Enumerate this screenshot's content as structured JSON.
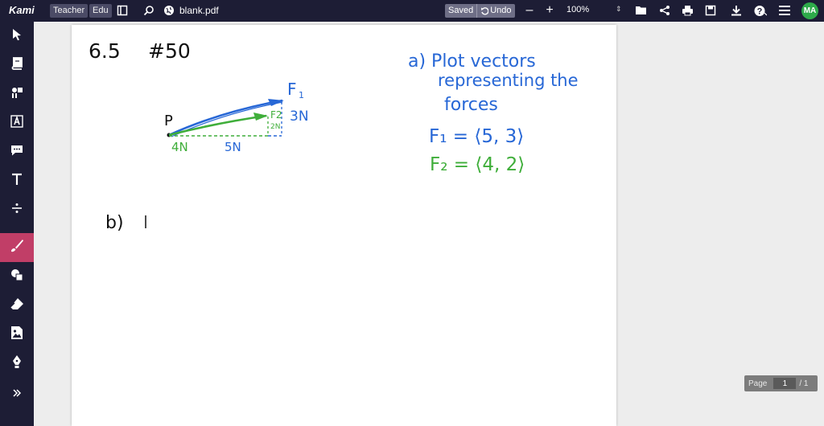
{
  "app": {
    "brand": "Kami"
  },
  "topbar": {
    "teacher_chip": "Teacher",
    "edu_chip": "Edu",
    "filename": "blank.pdf",
    "saved_label": "Saved",
    "undo_label": "Undo",
    "zoom_minus": "–",
    "zoom_plus": "+",
    "zoom_level": "100%",
    "avatar_initials": "MA",
    "accent_color": "#1d1d35"
  },
  "left_tools": [
    {
      "name": "select-tool",
      "icon": "cursor-icon"
    },
    {
      "name": "dictionary-tool",
      "icon": "book-icon"
    },
    {
      "name": "text-to-speech-tool",
      "icon": "speaker-icon"
    },
    {
      "name": "markup-tool",
      "icon": "highlight-icon"
    },
    {
      "name": "comment-tool",
      "icon": "comment-icon"
    },
    {
      "name": "text-tool",
      "icon": "text-icon"
    },
    {
      "name": "equation-tool",
      "icon": "divide-icon"
    },
    {
      "name": "drawing-tool",
      "icon": "brush-icon",
      "active": true
    },
    {
      "name": "shapes-tool",
      "icon": "shapes-icon"
    },
    {
      "name": "eraser-tool",
      "icon": "eraser-icon"
    },
    {
      "name": "image-tool",
      "icon": "image-icon"
    },
    {
      "name": "signature-tool",
      "icon": "pen-nib-icon"
    },
    {
      "name": "expand-tool",
      "icon": "expand-icon"
    }
  ],
  "page_indicator": {
    "label": "Page",
    "current": "1",
    "total": "/ 1"
  },
  "handwriting": {
    "problem_number": "6.5",
    "problem_item": "#50",
    "point_label": "P",
    "f1_label": "F",
    "f1_sub": "1",
    "f1_magnitude": "3N",
    "f2_label": "F2",
    "f2_magnitude": "2N",
    "x_label_green": "4N",
    "x_label_blue": "5N",
    "part_a_line1": "a) Plot vectors",
    "part_a_line2": "representing the",
    "part_a_line3": "forces",
    "eq_f1": "F₁ = ⟨5, 3⟩",
    "eq_f2": "F₂ = ⟨4, 2⟩",
    "part_b": "b)",
    "blue_ink": "#2767d6",
    "green_ink": "#3fae3a"
  }
}
